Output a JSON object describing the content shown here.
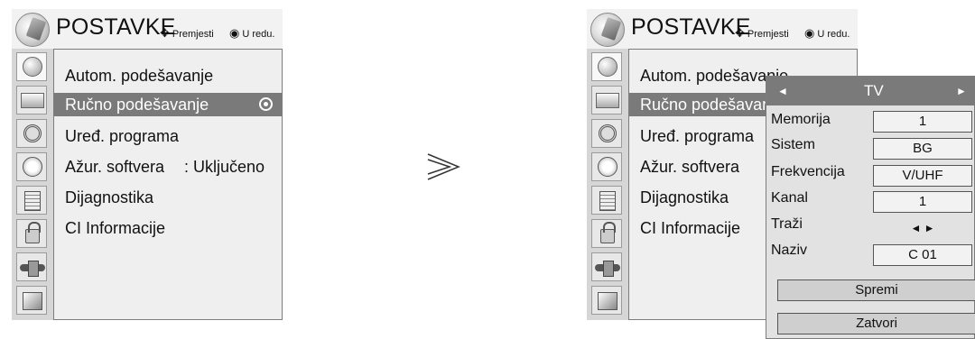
{
  "menu": {
    "title": "POSTAVKE",
    "hint_move": "Premjesti",
    "hint_ok": "U redu.",
    "side_icons": [
      "setup-icon",
      "picture-icon",
      "audio-icon",
      "time-icon",
      "option-icon",
      "lock-icon",
      "input-icon",
      "usb-icon"
    ],
    "items": [
      {
        "label": "Autom. podešavanje",
        "value": ""
      },
      {
        "label": "Ručno podešavanje",
        "value": ""
      },
      {
        "label": "Uređ. programa",
        "value": ""
      },
      {
        "label": "Ažur. softvera",
        "value": ": Uključeno"
      },
      {
        "label": "Dijagnostika",
        "value": ""
      },
      {
        "label": "CI Informacije",
        "value": ""
      }
    ],
    "selected_index": 1
  },
  "menu_right": {
    "items": [
      {
        "label": "Autom. podešavanje"
      },
      {
        "label": "Ručno podešavanje"
      },
      {
        "label": "Uređ. programa"
      },
      {
        "label": "Ažur. softvera"
      },
      {
        "label": "Dijagnostika"
      },
      {
        "label": "CI Informacije"
      }
    ]
  },
  "popup": {
    "header": "TV",
    "left_arrow": "◄",
    "right_arrow": "►",
    "fields": [
      {
        "label": "Memorija",
        "value": "1"
      },
      {
        "label": "Sistem",
        "value": "BG"
      },
      {
        "label": "Frekvencija",
        "value": "V/UHF"
      },
      {
        "label": "Kanal",
        "value": "1"
      },
      {
        "label": "Traži",
        "value": "◄ ►"
      },
      {
        "label": "Naziv",
        "value": "C  01"
      }
    ],
    "save_label": "Spremi",
    "close_label": "Zatvori"
  }
}
